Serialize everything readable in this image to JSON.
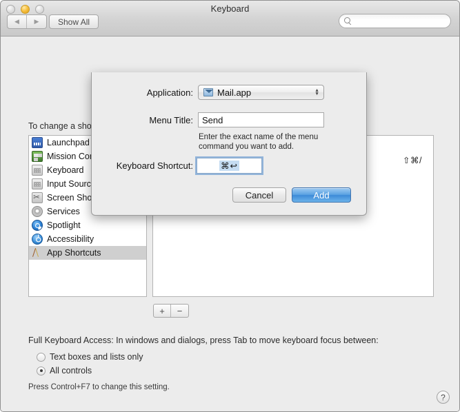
{
  "window": {
    "title": "Keyboard",
    "traffic_lights": [
      "close",
      "minimize",
      "zoom"
    ],
    "back_label": "◀",
    "forward_label": "▶",
    "show_all_label": "Show All",
    "search_placeholder": ""
  },
  "main": {
    "instruction": "To change a shortcut, select it, click the key combination, and then type the new keys.",
    "categories": [
      {
        "label": "Launchpad & Dock",
        "icon": "launchpad-icon",
        "selected": false
      },
      {
        "label": "Mission Control",
        "icon": "mission-control-icon",
        "selected": false
      },
      {
        "label": "Keyboard",
        "icon": "keyboard-icon",
        "selected": false
      },
      {
        "label": "Input Sources",
        "icon": "input-sources-icon",
        "selected": false
      },
      {
        "label": "Screen Shots",
        "icon": "screen-shots-icon",
        "selected": false
      },
      {
        "label": "Services",
        "icon": "services-gear-icon",
        "selected": false
      },
      {
        "label": "Spotlight",
        "icon": "spotlight-icon",
        "selected": false
      },
      {
        "label": "Accessibility",
        "icon": "accessibility-icon",
        "selected": false
      },
      {
        "label": "App Shortcuts",
        "icon": "app-shortcuts-icon",
        "selected": true
      }
    ],
    "right_panel_shortcut": "⇧⌘/",
    "add_button_label": "+",
    "remove_button_label": "−"
  },
  "full_keyboard_access": {
    "label": "Full Keyboard Access: In windows and dialogs, press Tab to move keyboard focus between:",
    "option_text_boxes": "Text boxes and lists only",
    "option_all_controls": "All controls",
    "selected": "all_controls",
    "hint": "Press Control+F7 to change this setting."
  },
  "help": {
    "label": "?"
  },
  "sheet": {
    "application_label": "Application:",
    "application_value": "Mail.app",
    "menu_title_label": "Menu Title:",
    "menu_title_value": "Send",
    "hint": "Enter the exact name of the menu command you want to add.",
    "shortcut_label": "Keyboard Shortcut:",
    "shortcut_value": "⌘↩",
    "cancel_label": "Cancel",
    "add_label": "Add"
  },
  "colors": {
    "window_bg": "#ececec",
    "accent_blue": "#3d8ad8",
    "selection_blue": "#c5dcf2",
    "selected_row": "#cfcfcf"
  }
}
